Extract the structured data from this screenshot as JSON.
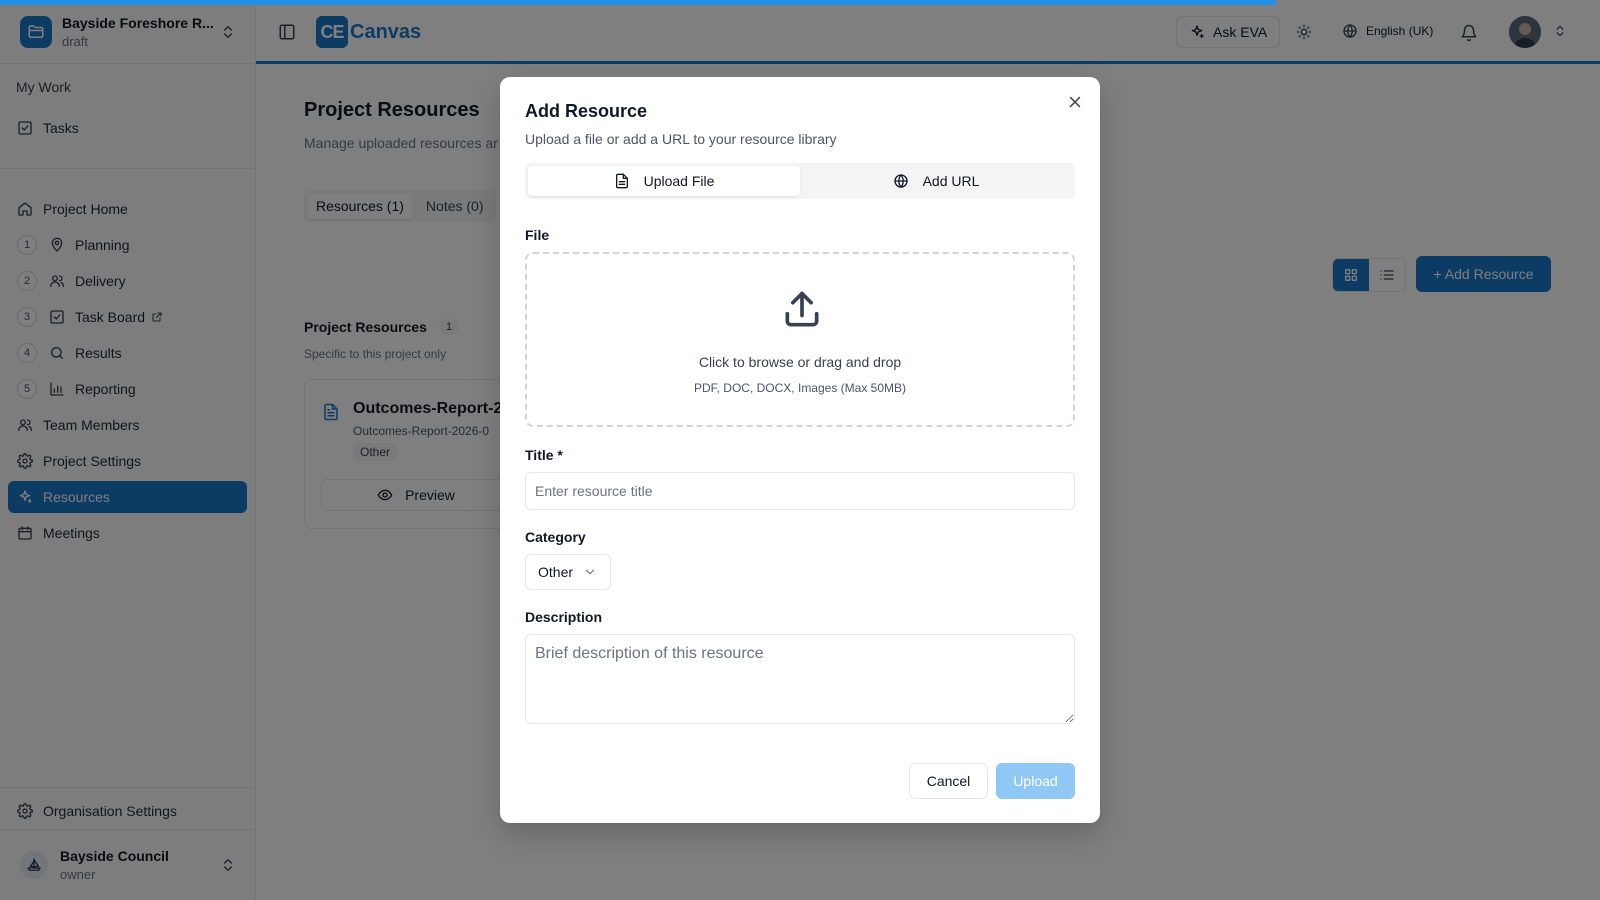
{
  "app": {
    "project_name": "Bayside Foreshore R...",
    "project_status": "draft",
    "brand_mark": "CE",
    "brand_text": "Canvas"
  },
  "header": {
    "ask_eva": "Ask EVA",
    "language": "English (UK)"
  },
  "sidebar": {
    "my_work_title": "My Work",
    "tasks": "Tasks",
    "project_home": "Project Home",
    "steps": [
      {
        "num": "1",
        "label": "Planning"
      },
      {
        "num": "2",
        "label": "Delivery"
      },
      {
        "num": "3",
        "label": "Task Board"
      },
      {
        "num": "4",
        "label": "Results"
      },
      {
        "num": "5",
        "label": "Reporting"
      }
    ],
    "team_members": "Team Members",
    "project_settings": "Project Settings",
    "resources": "Resources",
    "meetings": "Meetings",
    "organisation_settings": "Organisation Settings",
    "org_name": "Bayside Council",
    "org_role": "owner"
  },
  "main": {
    "title": "Project Resources",
    "subtitle": "Manage uploaded resources ar",
    "tabs": [
      {
        "label": "Resources (1)",
        "active": true
      },
      {
        "label": "Notes (0)",
        "active": false
      }
    ],
    "add_resource": "+ Add Resource",
    "section_title": "Project Resources",
    "section_count": "1",
    "section_sub": "Specific to this project only",
    "card": {
      "name": "Outcomes-Report-2",
      "file": "Outcomes-Report-2026-0",
      "tag": "Other",
      "preview": "Preview"
    }
  },
  "modal": {
    "title": "Add Resource",
    "subtitle": "Upload a file or add a URL to your resource library",
    "tab_upload": "Upload File",
    "tab_url": "Add URL",
    "file_label": "File",
    "dropzone_main": "Click to browse or drag and drop",
    "dropzone_sub": "PDF, DOC, DOCX, Images (Max 50MB)",
    "title_label": "Title *",
    "title_placeholder": "Enter resource title",
    "category_label": "Category",
    "category_value": "Other",
    "description_label": "Description",
    "description_placeholder": "Brief description of this resource",
    "cancel": "Cancel",
    "upload": "Upload"
  },
  "colors": {
    "accent": "#1876c9",
    "progress": "#1e90e8",
    "upload_disabled": "#8fc8f5"
  },
  "icons": [
    "folder-icon",
    "chevron-updown-icon",
    "check-square-icon",
    "home-icon",
    "map-pin-icon",
    "users-icon",
    "search-icon",
    "bar-chart-icon",
    "gear-icon",
    "sparkle-icon",
    "calendar-icon",
    "external-link-icon",
    "panel-icon",
    "sun-icon",
    "globe-icon",
    "bell-icon",
    "grid-icon",
    "list-icon",
    "file-icon",
    "eye-icon",
    "close-icon",
    "upload-icon",
    "chevron-down-icon"
  ]
}
